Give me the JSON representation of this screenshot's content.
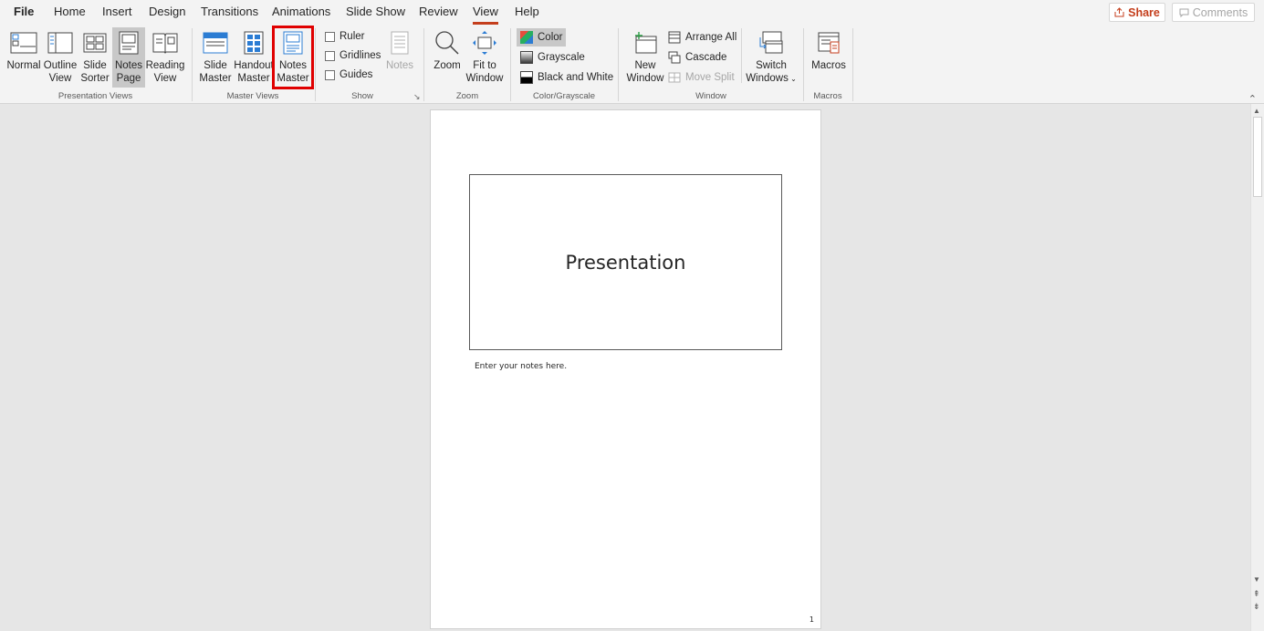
{
  "tabs": {
    "file": "File",
    "home": "Home",
    "insert": "Insert",
    "design": "Design",
    "transitions": "Transitions",
    "animations": "Animations",
    "slideshow": "Slide Show",
    "review": "Review",
    "view": "View",
    "help": "Help"
  },
  "top_right": {
    "share": "Share",
    "comments": "Comments"
  },
  "ribbon": {
    "presentation_views": {
      "label": "Presentation Views",
      "normal": "Normal",
      "outline_1": "Outline",
      "outline_2": "View",
      "sorter_1": "Slide",
      "sorter_2": "Sorter",
      "notespage_1": "Notes",
      "notespage_2": "Page",
      "reading_1": "Reading",
      "reading_2": "View"
    },
    "master_views": {
      "label": "Master Views",
      "slide_1": "Slide",
      "slide_2": "Master",
      "handout_1": "Handout",
      "handout_2": "Master",
      "notes_1": "Notes",
      "notes_2": "Master"
    },
    "show": {
      "label": "Show",
      "ruler": "Ruler",
      "gridlines": "Gridlines",
      "guides": "Guides",
      "notes": "Notes"
    },
    "zoom": {
      "label": "Zoom",
      "zoom": "Zoom",
      "fit_1": "Fit to",
      "fit_2": "Window"
    },
    "color_grayscale": {
      "label": "Color/Grayscale",
      "color": "Color",
      "grayscale": "Grayscale",
      "bw": "Black and White"
    },
    "window": {
      "label": "Window",
      "new_1": "New",
      "new_2": "Window",
      "arrange": "Arrange All",
      "cascade": "Cascade",
      "move_split": "Move Split",
      "switch_1": "Switch",
      "switch_2": "Windows"
    },
    "macros": {
      "label": "Macros",
      "macros": "Macros"
    }
  },
  "notes_page": {
    "slide_title": "Presentation",
    "notes_placeholder": "Enter your notes here.",
    "page_number": "1"
  },
  "colors": {
    "accent": "#c43e1c",
    "highlight_box": "#e00000",
    "ribbon_bg": "#f3f3f3",
    "workspace_bg": "#e6e6e6"
  }
}
